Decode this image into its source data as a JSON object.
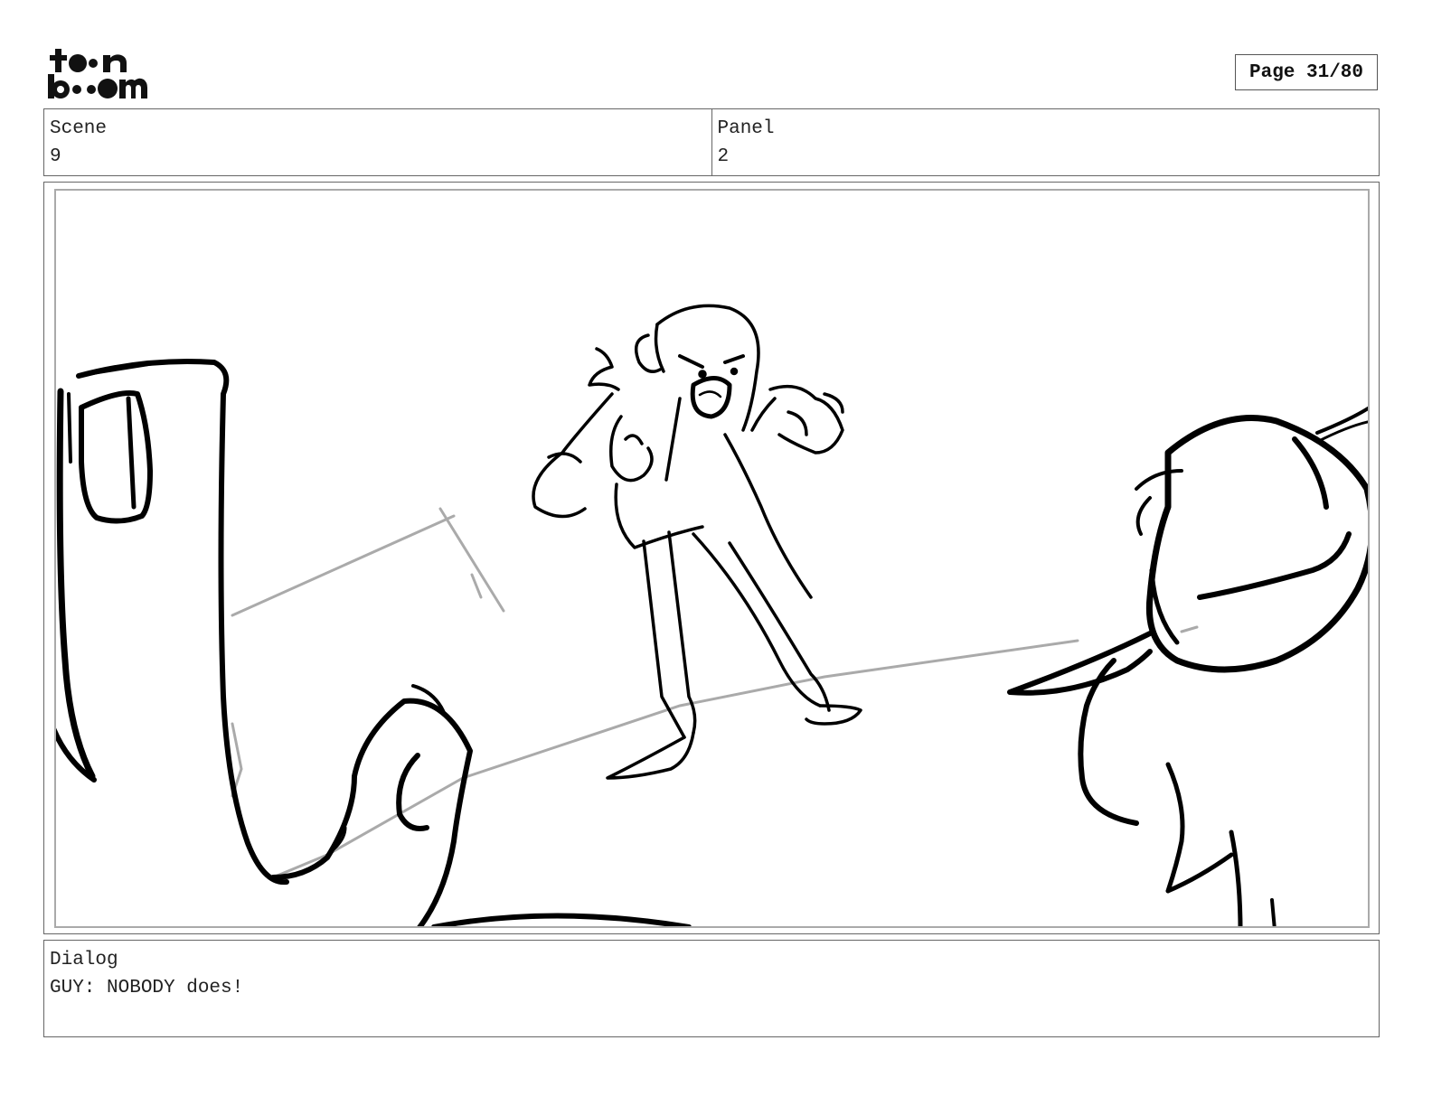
{
  "header": {
    "logo": {
      "icon": "toon-boom-logo",
      "line1": "toon",
      "line2": "boom"
    },
    "page_label": "Page 31/80"
  },
  "scene": {
    "label": "Scene",
    "value": "9"
  },
  "panel": {
    "label": "Panel",
    "value": "2"
  },
  "drawing": {
    "icon": "storyboard-sketch"
  },
  "dialog": {
    "label": "Dialog",
    "text": "GUY: NOBODY does!"
  }
}
